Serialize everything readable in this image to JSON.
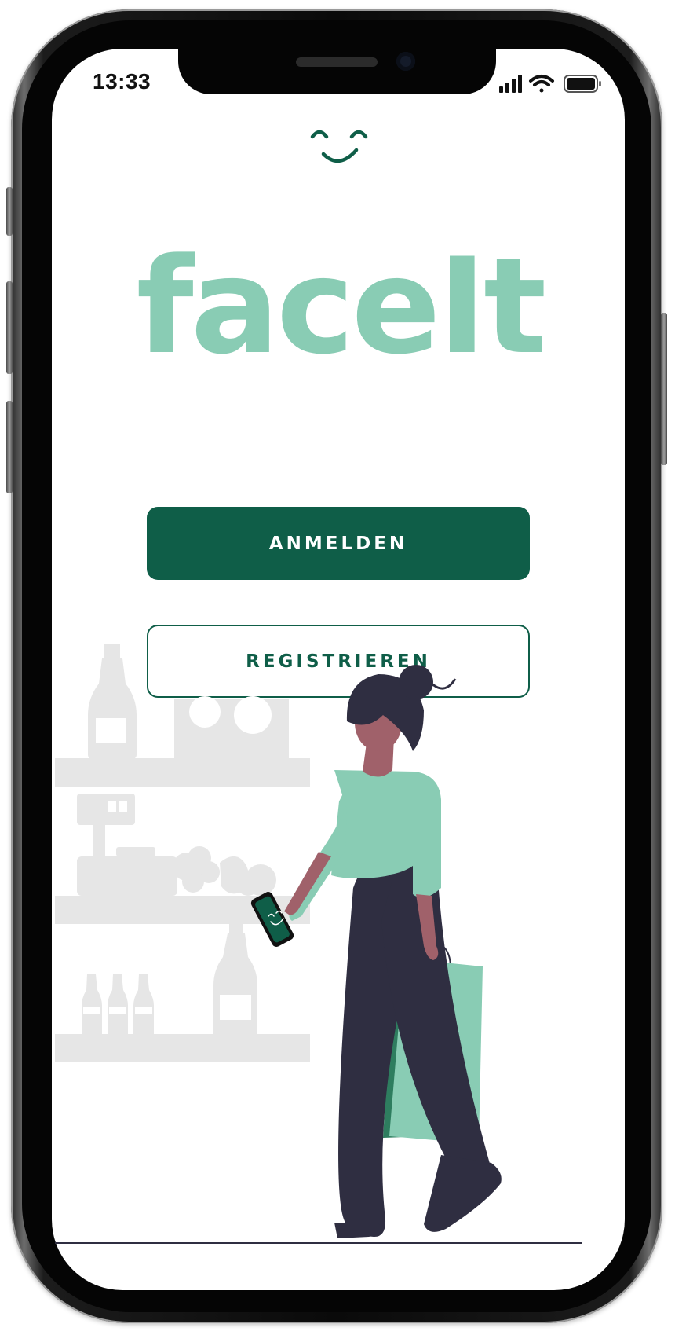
{
  "status_bar": {
    "time": "13:33",
    "icons": [
      "cellular-signal-icon",
      "wifi-icon",
      "battery-icon"
    ]
  },
  "app": {
    "logo_icon": "smile-face-icon",
    "brand_name": "faceIt",
    "brand_color": "#89ccb4",
    "accent_color": "#0f5e48"
  },
  "actions": {
    "login_label": "ANMELDEN",
    "register_label": "REGISTRIEREN"
  },
  "illustration": {
    "name": "woman-shopping-illustration"
  }
}
